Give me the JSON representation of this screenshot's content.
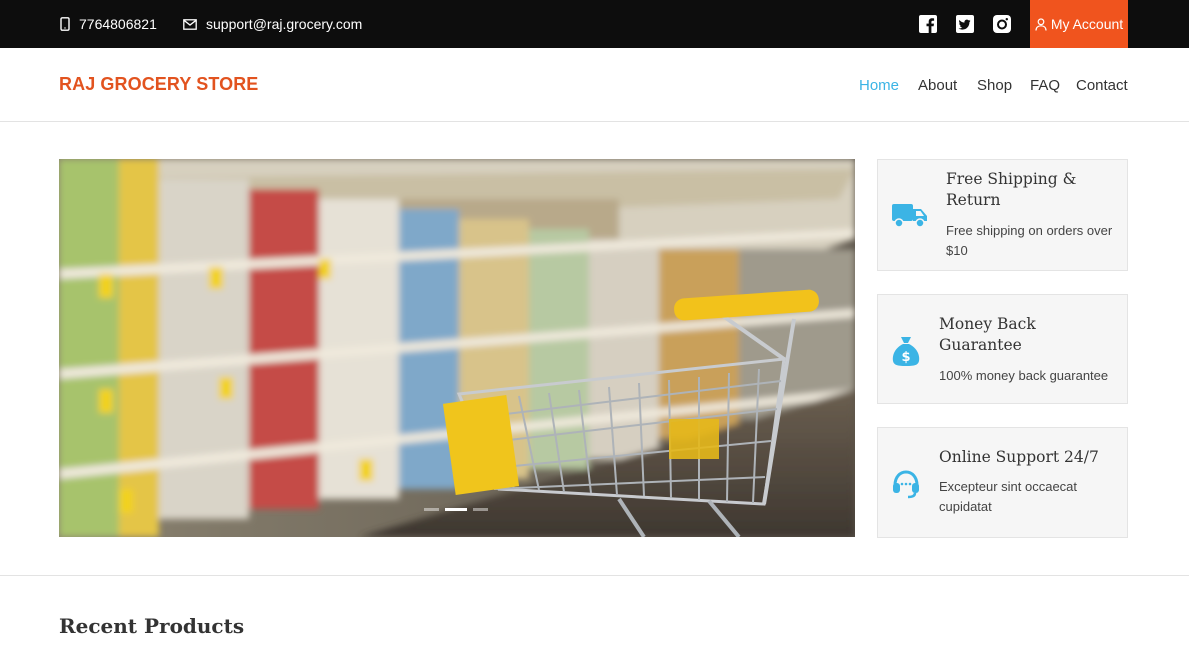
{
  "topbar": {
    "phone": "7764806821",
    "email": "support@raj.grocery.com",
    "social": [
      "facebook-icon",
      "twitter-icon",
      "instagram-icon"
    ],
    "account_label": "My Account",
    "account_color": "#f0541e",
    "background": "#0d0d0d"
  },
  "navbar": {
    "brand": "RAJ GROCERY STORE",
    "brand_color": "#e2531f",
    "items": [
      {
        "label": "Home",
        "active": true
      },
      {
        "label": "About",
        "active": false
      },
      {
        "label": "Shop",
        "active": false
      },
      {
        "label": "FAQ",
        "active": false
      },
      {
        "label": "Contact",
        "active": false
      }
    ],
    "active_color": "#3bb4e5"
  },
  "hero": {
    "image": "supermarket aisle with yellow shopping cart",
    "slides": 3,
    "active_slide": 2
  },
  "features": [
    {
      "icon": "truck-icon",
      "title": "Free Shipping & Return",
      "text": "Free shipping on orders over $10"
    },
    {
      "icon": "money-bag-icon",
      "title": "Money Back Guarantee",
      "text": "100% money back guarantee"
    },
    {
      "icon": "headset-icon",
      "title": "Online Support 24/7",
      "text": "Excepteur sint occaecat cupidatat"
    }
  ],
  "feature_icon_color": "#3bb4e5",
  "recent": {
    "title": "Recent Products"
  }
}
